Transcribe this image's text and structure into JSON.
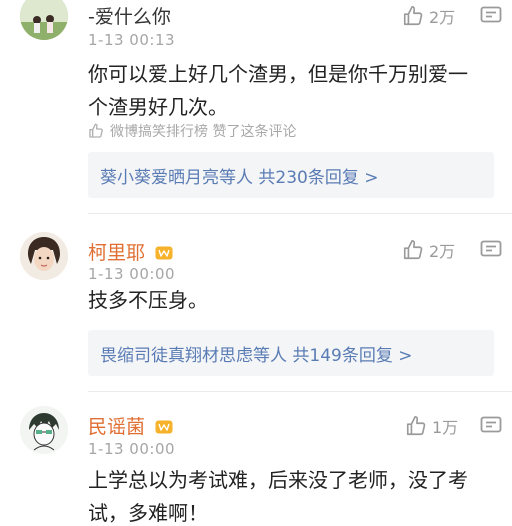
{
  "comments": [
    {
      "username": "-爱什么你",
      "time": "1-13 00:13",
      "like_count": "2万",
      "body_line1": "你可以爱上好几个渣男，但是你千万别爱一",
      "body_line2": "个渣男好几次。",
      "liked_by": "微博搞笑排行榜 赞了这条评论",
      "replies": "葵小葵爱晒月亮等人 共230条回复 >"
    },
    {
      "username": "柯里耶",
      "time": "1-13 00:00",
      "like_count": "2万",
      "body_line1": "技多不压身。",
      "replies": "畏缩司徒真翔材思虑等人 共149条回复 >"
    },
    {
      "username": "民谣菌",
      "time": "1-13 00:00",
      "like_count": "1万",
      "body_line1": "上学总以为考试难，后来没了老师，没了考",
      "body_line2": "试，多难啊！"
    }
  ],
  "colors": {
    "username": "#e06f33",
    "link": "#5a7cb4",
    "meta": "#a6a6a6"
  }
}
